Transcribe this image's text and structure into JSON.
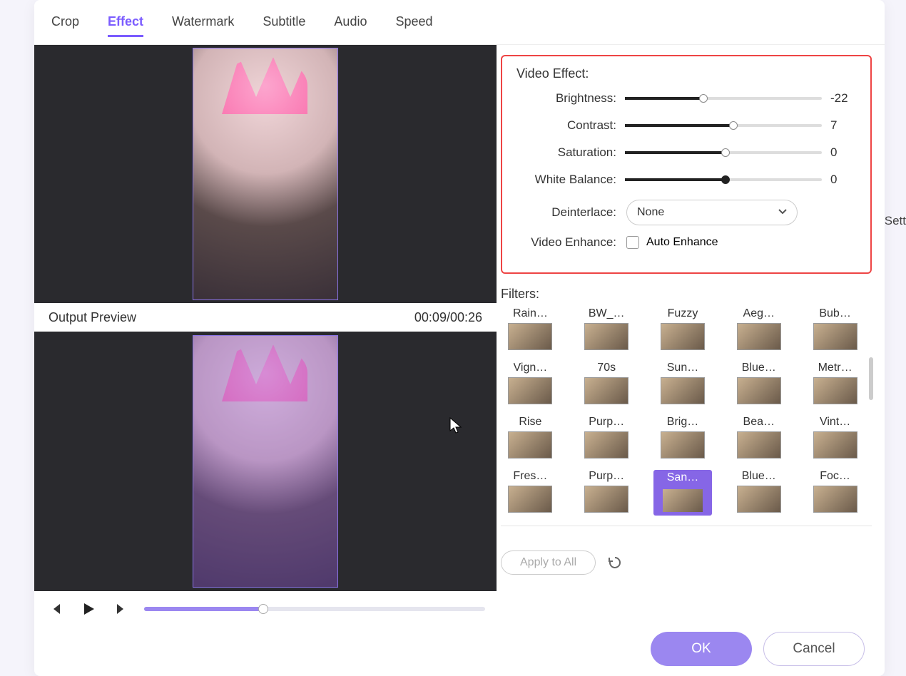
{
  "tabs": {
    "crop": "Crop",
    "effect": "Effect",
    "watermark": "Watermark",
    "subtitle": "Subtitle",
    "audio": "Audio",
    "speed": "Speed",
    "active": "effect"
  },
  "preview": {
    "output_label": "Output Preview",
    "time": "00:09/00:26",
    "timeline_pct": 35
  },
  "effect": {
    "title": "Video Effect:",
    "brightness": {
      "label": "Brightness:",
      "value": -22,
      "pct": 40
    },
    "contrast": {
      "label": "Contrast:",
      "value": 7,
      "pct": 55
    },
    "saturation": {
      "label": "Saturation:",
      "value": 0,
      "pct": 51
    },
    "white_balance": {
      "label": "White Balance:",
      "value": 0,
      "pct": 51
    },
    "deinterlace": {
      "label": "Deinterlace:",
      "value": "None"
    },
    "enhance": {
      "label": "Video Enhance:",
      "option": "Auto Enhance",
      "checked": false
    }
  },
  "filters": {
    "title": "Filters:",
    "items": [
      {
        "label": "Rain…"
      },
      {
        "label": "BW_…"
      },
      {
        "label": "Fuzzy"
      },
      {
        "label": "Aeg…"
      },
      {
        "label": "Bub…"
      },
      {
        "label": "Vign…"
      },
      {
        "label": "70s"
      },
      {
        "label": "Sun…"
      },
      {
        "label": "Blue…"
      },
      {
        "label": "Metr…"
      },
      {
        "label": "Rise"
      },
      {
        "label": "Purp…"
      },
      {
        "label": "Brig…"
      },
      {
        "label": "Bea…"
      },
      {
        "label": "Vint…"
      },
      {
        "label": "Fres…"
      },
      {
        "label": "Purp…"
      },
      {
        "label": "San…",
        "selected": true
      },
      {
        "label": "Blue…"
      },
      {
        "label": "Foc…"
      }
    ],
    "apply": "Apply to All"
  },
  "buttons": {
    "ok": "OK",
    "cancel": "Cancel"
  },
  "side": "Sett"
}
